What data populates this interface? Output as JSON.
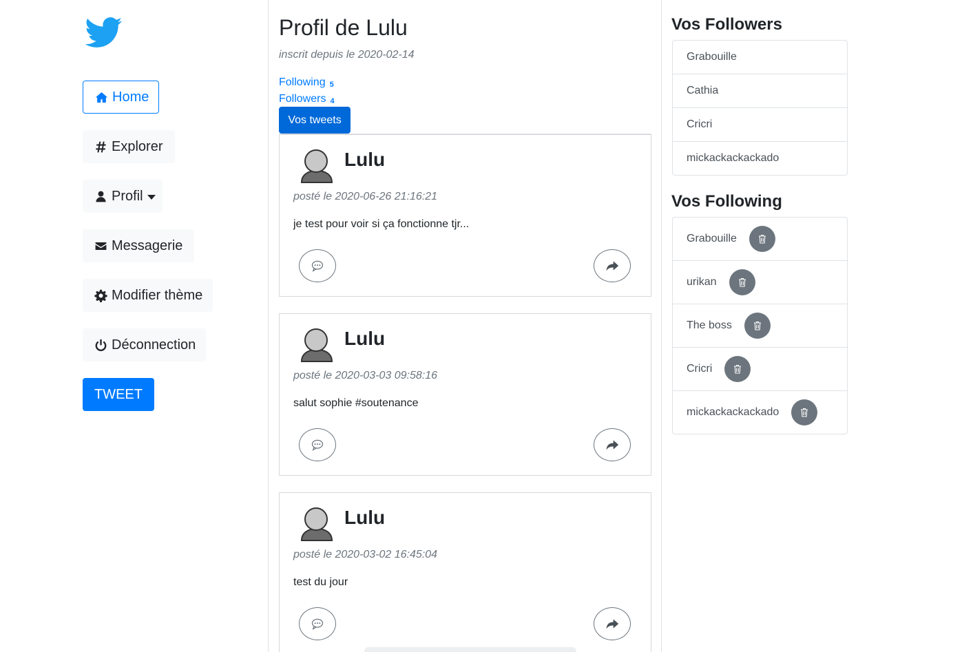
{
  "sidebar": {
    "logo_icon": "twitter-bird-icon",
    "items": [
      {
        "icon": "home-icon",
        "label": "Home"
      },
      {
        "icon": "hashtag-icon",
        "label": "Explorer"
      },
      {
        "icon": "user-icon",
        "label": "Profil"
      },
      {
        "icon": "envelope-icon",
        "label": "Messagerie"
      },
      {
        "icon": "gear-icon",
        "label": "Modifier thème"
      },
      {
        "icon": "power-icon",
        "label": "Déconnection"
      }
    ],
    "tweet_label": "TWEET"
  },
  "profile": {
    "title": "Profil de Lulu",
    "since": "inscrit depuis le 2020-02-14",
    "following_label": "Following",
    "following_count": "5",
    "followers_label": "Followers",
    "followers_count": "4",
    "tab_label": "Vos tweets"
  },
  "tweets": [
    {
      "author": "Lulu",
      "date": "posté le 2020-06-26 21:16:21",
      "text": "je test pour voir si ça fonctionne tjr..."
    },
    {
      "author": "Lulu",
      "date": "posté le 2020-03-03 09:58:16",
      "text": "salut sophie #soutenance"
    },
    {
      "author": "Lulu",
      "date": "posté le 2020-03-02 16:45:04",
      "text": "test du jour"
    }
  ],
  "followers": {
    "title": "Vos Followers",
    "items": [
      "Grabouille",
      "Cathia",
      "Cricri",
      "mickackackackado"
    ]
  },
  "following": {
    "title": "Vos Following",
    "items": [
      "Grabouille",
      "urikan",
      "The boss",
      "Cricri",
      "mickackackackado"
    ]
  },
  "colors": {
    "accent": "#007bff",
    "accent_active": "#0069d9",
    "twitter": "#1da1f2",
    "muted": "#6c757d",
    "light": "#f8f9fa",
    "border": "#dee2e6"
  }
}
